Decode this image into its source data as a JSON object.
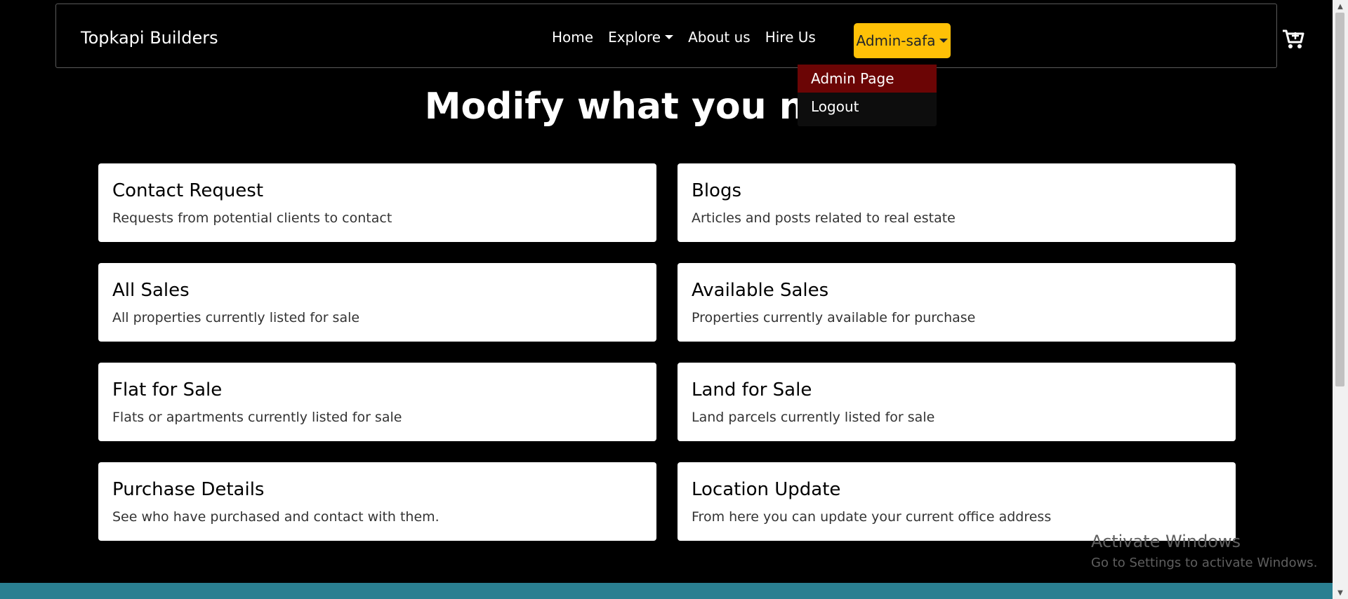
{
  "navbar": {
    "brand": "Topkapi Builders",
    "links": {
      "home": "Home",
      "explore": "Explore",
      "about": "About us",
      "hire": "Hire Us"
    },
    "admin_label": "Admin-safa",
    "cart_icon": "cart-plus-icon"
  },
  "dropdown": {
    "items": [
      {
        "label": "Admin Page"
      },
      {
        "label": "Logout"
      }
    ]
  },
  "hero": {
    "title": "Modify what you need!"
  },
  "cards": [
    {
      "title": "Contact Request",
      "text": "Requests from potential clients to contact"
    },
    {
      "title": "Blogs",
      "text": "Articles and posts related to real estate"
    },
    {
      "title": "All Sales",
      "text": "All properties currently listed for sale"
    },
    {
      "title": "Available Sales",
      "text": "Properties currently available for purchase"
    },
    {
      "title": "Flat for Sale",
      "text": "Flats or apartments currently listed for sale"
    },
    {
      "title": "Land for Sale",
      "text": "Land parcels currently listed for sale"
    },
    {
      "title": "Purchase Details",
      "text": "See who have purchased and contact with them."
    },
    {
      "title": "Location Update",
      "text": "From here you can update your current office address"
    }
  ],
  "watermark": {
    "title": "Activate Windows",
    "subtitle": "Go to Settings to activate Windows."
  },
  "colors": {
    "accent": "#ffc107",
    "dropdown_active": "#6b0505",
    "footer": "#2a7f91"
  }
}
